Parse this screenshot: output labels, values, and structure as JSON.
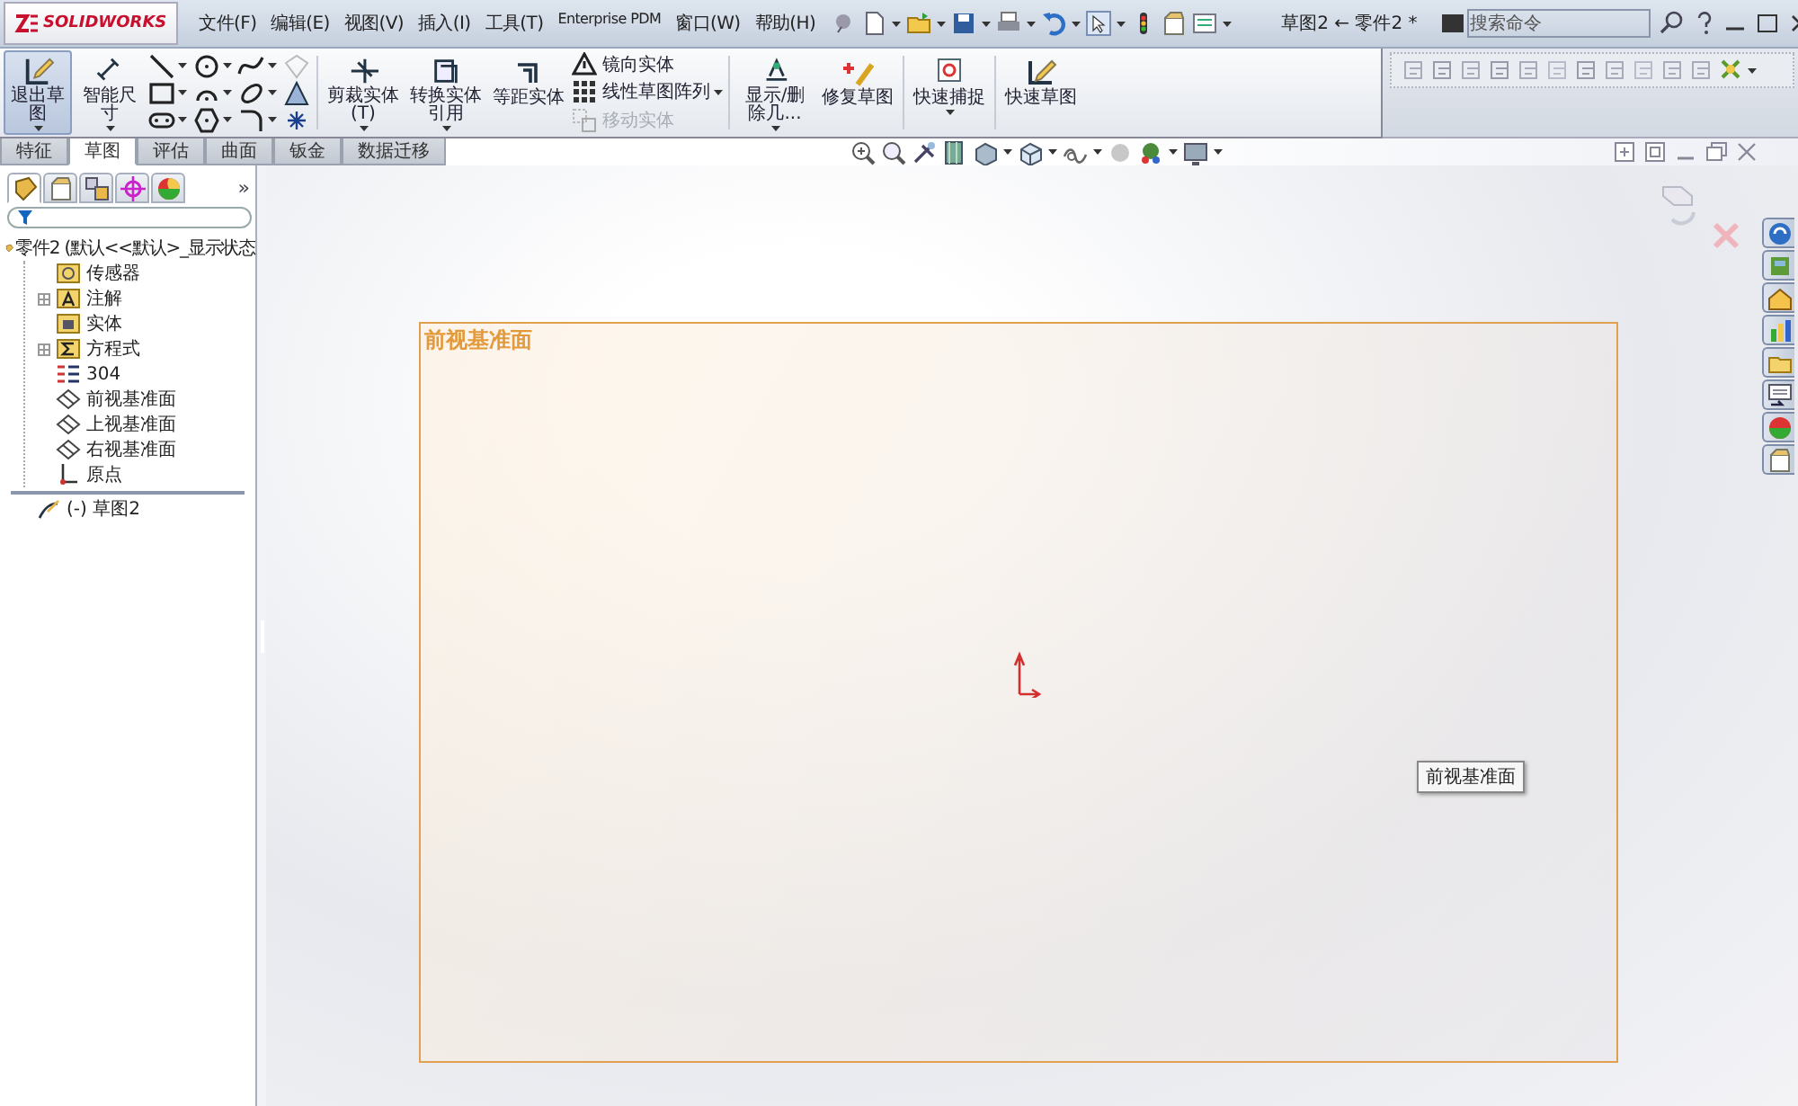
{
  "app": {
    "logo": "SOLIDWORKS"
  },
  "menus": [
    {
      "label": "文件(F)"
    },
    {
      "label": "编辑(E)"
    },
    {
      "label": "视图(V)"
    },
    {
      "label": "插入(I)"
    },
    {
      "label": "工具(T)"
    },
    {
      "label": "Enterprise PDM"
    },
    {
      "label": "窗口(W)"
    },
    {
      "label": "帮助(H)"
    }
  ],
  "quick_access": [
    {
      "kind": "pin",
      "dropdown": false
    },
    {
      "kind": "new",
      "dropdown": true
    },
    {
      "kind": "open",
      "dropdown": true
    },
    {
      "kind": "save",
      "dropdown": true
    },
    {
      "kind": "print",
      "dropdown": true
    },
    {
      "kind": "undo",
      "dropdown": true
    },
    {
      "kind": "select",
      "dropdown": true
    },
    {
      "kind": "rebuild",
      "dropdown": false
    },
    {
      "kind": "file-props",
      "dropdown": false
    },
    {
      "kind": "options",
      "dropdown": true
    }
  ],
  "window": {
    "title": "草图2 ← 零件2 *"
  },
  "search": {
    "placeholder": "搜索命令"
  },
  "ribbon": {
    "large_buttons": [
      {
        "label": "退出草图",
        "selected": true,
        "dropdown": true
      },
      {
        "label": "智能尺寸",
        "selected": false,
        "dropdown": true
      }
    ],
    "entity_tools": [
      {
        "kind": "line"
      },
      {
        "kind": "circle"
      },
      {
        "kind": "spline"
      },
      {
        "kind": "plane-faded"
      },
      {
        "kind": "rectangle"
      },
      {
        "kind": "arc"
      },
      {
        "kind": "ellipse"
      },
      {
        "kind": "triangle"
      },
      {
        "kind": "slot"
      },
      {
        "kind": "polygon"
      },
      {
        "kind": "fillet"
      },
      {
        "kind": "point"
      }
    ],
    "commands": [
      {
        "label": "剪裁实体(T)",
        "dropdown": true
      },
      {
        "label": "转换实体引用",
        "dropdown": true
      },
      {
        "label": "等距实体",
        "dropdown": false
      }
    ],
    "small_commands": [
      {
        "label": "镜向实体",
        "disabled": false
      },
      {
        "label": "线性草图阵列",
        "disabled": false
      },
      {
        "label": "移动实体",
        "disabled": true
      }
    ],
    "end_commands": [
      {
        "label": "显示/删除几...",
        "dropdown": true
      },
      {
        "label": "修复草图",
        "dropdown": false
      },
      {
        "label": "快速捕捉",
        "dropdown": true
      },
      {
        "label": "快速草图",
        "dropdown": false
      }
    ]
  },
  "tabs": [
    {
      "label": "特征",
      "selected": false
    },
    {
      "label": "草图",
      "selected": true
    },
    {
      "label": "评估",
      "selected": false
    },
    {
      "label": "曲面",
      "selected": false
    },
    {
      "label": "钣金",
      "selected": false
    },
    {
      "label": "数据迁移",
      "selected": false
    }
  ],
  "panel_tabs": [
    {
      "kind": "feature-tree",
      "selected": true
    },
    {
      "kind": "property",
      "selected": false
    },
    {
      "kind": "config",
      "selected": false
    },
    {
      "kind": "dimxpert",
      "selected": false
    },
    {
      "kind": "display",
      "selected": false
    }
  ],
  "panel_more": "»",
  "tree": {
    "label": "零件2 (默认<<默认>_显示状态",
    "children": [
      {
        "label": "传感器",
        "kind": "sensor",
        "collapsed": false
      },
      {
        "label": "注解",
        "kind": "annotation",
        "collapsed": true
      },
      {
        "label": "实体",
        "kind": "body",
        "collapsed": false
      },
      {
        "label": "方程式",
        "kind": "equation",
        "collapsed": true
      },
      {
        "label": "304",
        "kind": "material",
        "collapsed": false
      },
      {
        "label": "前视基准面",
        "kind": "plane",
        "collapsed": false
      },
      {
        "label": "上视基准面",
        "kind": "plane",
        "collapsed": false
      },
      {
        "label": "右视基准面",
        "kind": "plane",
        "collapsed": false
      },
      {
        "label": "原点",
        "kind": "origin",
        "collapsed": false
      }
    ]
  },
  "after_rollback": [
    {
      "label": "(-) 草图2",
      "kind": "sketch"
    }
  ],
  "graphics": {
    "plane_label": "前视基准面",
    "tooltip": "前视基准面"
  },
  "task_pane": [
    {
      "kind": "resources"
    },
    {
      "kind": "library"
    },
    {
      "kind": "explorer"
    },
    {
      "kind": "palette"
    },
    {
      "kind": "folder"
    },
    {
      "kind": "custom-props"
    },
    {
      "kind": "appearance"
    },
    {
      "kind": "forum"
    }
  ]
}
